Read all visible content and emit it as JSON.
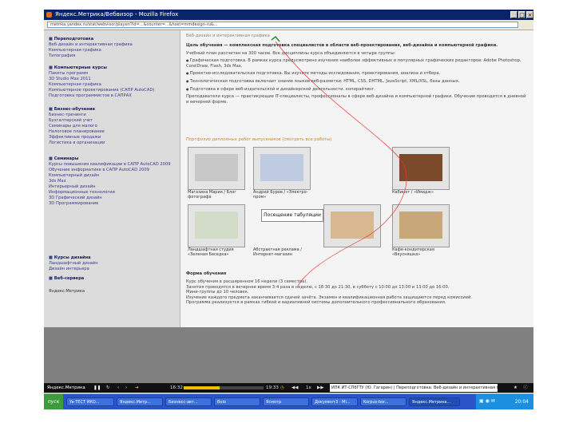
{
  "window": {
    "title": "Яндекс.Метрика/Вебвизор - Mozilla Firefox",
    "address": "metrika.yandex.ru/stat/webvisor/player/?id=...&counter=...&host=mmdesign-ru&...",
    "min": "_",
    "max": "□",
    "close": "×"
  },
  "sidebar": {
    "sections": [
      {
        "head": "Переподготовка",
        "items": [
          "Веб-дизайн и интерактивная графика",
          "Компьютерная графика",
          "Типография"
        ]
      },
      {
        "head": "Компьютерные курсы",
        "items": [
          "Пакеты программ",
          "3D Studio Max 2011",
          "Компьютерная графика",
          "Компьютерное проектирование (САПР AutoCAD)",
          "Подготовка программистов в САПРАХ"
        ]
      },
      {
        "head": "Бизнес-обучение",
        "items": [
          "Бизнес-тренинги",
          "Бухгалтерский учет",
          "Семинары для малого",
          "Налоговое планирование",
          "Эффективные продажи",
          "Логистика в организации"
        ]
      },
      {
        "head": "Семинары",
        "items": [
          "Курсы повышения квалификации в САПР AutoCAD 2009",
          "Обучение информатике в САПР AutoCAD 2009",
          "Компьютерный дизайн",
          "3ds Max",
          "Интерьерный дизайн",
          "Информационные технологии",
          "3D Графический дизайн",
          "3D Программирование"
        ]
      },
      {
        "head": "Курсы дизайна",
        "items": [
          "Ландшафтный дизайн",
          "Дизайн интерьера"
        ]
      },
      {
        "head": "Веб-сервера",
        "items": []
      }
    ],
    "counter": "Яндекс.Метрика"
  },
  "content": {
    "breadcrumb": "Веб-дизайн и интерактивная графика",
    "intro": "Цель обучения — комплексная подготовка специалистов в области веб-проектирования, веб-дизайна и компьютерной графики.",
    "hours": "Учебный план рассчитан на 300 часов. Все дисциплины курса объединяются в четыре группы:",
    "bullets": [
      "Графическая подготовка. В рамках курса предусмотрено изучение наиболее эффективных и популярных графических редакторов: Adobe Photoshop, CorelDraw, Flash, 3ds Max.",
      "Проектно-исследовательская подготовка. Вы изучите методы исследования, проектирования, анализа и отбора.",
      "Технологическая подготовка включает знание языков веб-разметки: HTML, CSS, DHTML, JavaScript, XML/XSL, базы данных.",
      "Подготовка в сфере веб-издательской и дизайнерской деятельности, копирайтинг."
    ],
    "after": "Преподаватели курса — практикующие IT-специалисты, профессионалы в сфере веб-дизайна и компьютерной графики. Обучение проводится в дневной и вечерней форме.",
    "portfolio_title": "Портфолио дипломных работ выпускников (смотреть все работы)",
    "thumbs_row1": [
      "Магазина Мария / Блог фотографа",
      "Андрей Буров / «Электро-пром»",
      "Кабинет / «Имидж»"
    ],
    "thumbs_row2": [
      "Ландшафтная студия «Зеленая Беседка»",
      "Абстрактная реклама / Интернет-магазин",
      "Кафе-кондитерская «Вкусняшка»"
    ],
    "tooltip": "Посещение табуляции",
    "schedule_title": "Форма обучения",
    "schedule": [
      "Курс обучения в расширенном 16 недели (3 семестра).",
      "Занятия проводятся в вечернее время 3-4 раза в неделю, с 18:30 до 21:30, в субботу с 10:00 до 13:00 и 13:00 до 16:00.",
      "Мини-группы до 10 человек.",
      "Изучение каждого предмета заканчивается сдачей зачёта. Экзамен и квалификационная работа защищаются перед комиссией.",
      "Программа реализуется в рамках гибкой и вариативной системы дополнительного профессионального образования."
    ]
  },
  "player": {
    "site": "Яндекс.Метрика",
    "time_start": "16:32",
    "time_end": "19:33",
    "speed": "1x",
    "page_title": "ИПК ИТ-СПбГТУ (Ю. Гагарин) | Переподготовка: Веб-дизайн и интерактивная графика...",
    "progress": 0.45
  },
  "taskbar": {
    "start": "пуск",
    "items": [
      "Ya-ТЕСТ ИКО...",
      "Яндекс.Метр...",
      "Бизнесс-авт...",
      "Bolo",
      "Ясмотр",
      "Документ3 - Mi...",
      "Korpus-bor...",
      "Яндекс.Метрика..."
    ],
    "clock": "20:04"
  },
  "colors": {
    "titlebar": "#0a246a",
    "taskbar": "#2a54c8",
    "link": "#3a3a8a",
    "accent": "#e06a1b"
  }
}
